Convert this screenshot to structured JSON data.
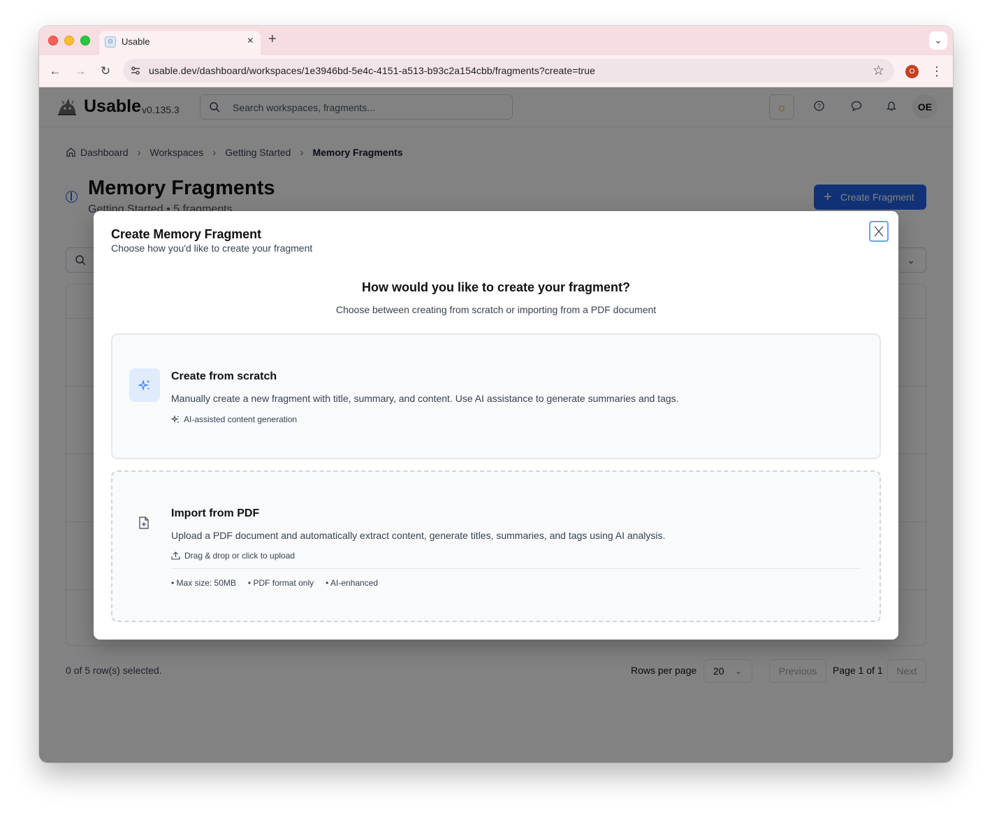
{
  "browser": {
    "tab_title": "Usable",
    "tab_favicon": "☺",
    "url": "usable.dev/dashboard/workspaces/1e3946bd-5e4c-4151-a513-b93c2a154cbb/fragments?create=true",
    "profile_initial": "O"
  },
  "app": {
    "name": "Usable",
    "version": "v0.135.3",
    "search_placeholder": "Search workspaces, fragments...",
    "avatar_initials": "OE"
  },
  "breadcrumb": {
    "items": [
      "Dashboard",
      "Workspaces",
      "Getting Started",
      "Memory Fragments"
    ]
  },
  "page": {
    "title": "Memory Fragments",
    "subtitle": "Getting Started • 5 fragments",
    "create_button": "Create Fragment"
  },
  "table": {
    "row_action": "...",
    "selection_status": "0 of 5 row(s) selected.",
    "rows_per_page_label": "Rows per page",
    "rows_per_page_value": "20",
    "previous": "Previous",
    "page_info": "Page 1 of 1",
    "next": "Next"
  },
  "modal": {
    "title": "Create Memory Fragment",
    "subtitle": "Choose how you'd like to create your fragment",
    "question": "How would you like to create your fragment?",
    "question_sub": "Choose between creating from scratch or importing from a PDF document",
    "options": [
      {
        "icon": "sparkles-icon",
        "title": "Create from scratch",
        "description": "Manually create a new fragment with title, summary, and content. Use AI assistance to generate summaries and tags.",
        "note": "AI-assisted content generation"
      },
      {
        "icon": "file-plus-icon",
        "title": "Import from PDF",
        "description": "Upload a PDF document and automatically extract content, generate titles, summaries, and tags using AI analysis.",
        "note": "Drag & drop or click to upload",
        "bullets": [
          "• Max size: 50MB",
          "• PDF format only",
          "• AI-enhanced"
        ]
      }
    ]
  },
  "colors": {
    "accent": "#2563eb",
    "tab_bar": "#f6dde2",
    "overlay": "rgba(0,0,0,0.49)",
    "close_focus": "#60a5fa"
  }
}
